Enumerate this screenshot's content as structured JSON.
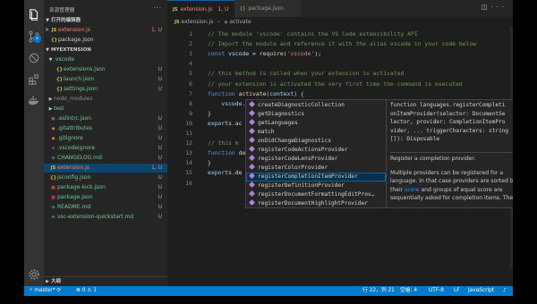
{
  "sidebar": {
    "title": "资源管理器",
    "open_editors_header": "打开的编辑器",
    "open_editors": [
      {
        "name": "extension.js",
        "icon": "js-icon",
        "status": "1, U"
      },
      {
        "name": "package.json",
        "icon": "json-icon",
        "status": ""
      }
    ],
    "project_header": "MYEXTENSION",
    "tree": [
      {
        "name": ".vscode",
        "type": "folder",
        "expanded": true,
        "status": ""
      },
      {
        "name": "extensions.json",
        "type": "json",
        "status": "U"
      },
      {
        "name": "launch.json",
        "type": "json",
        "status": "U"
      },
      {
        "name": "settings.json",
        "type": "json",
        "status": "U"
      },
      {
        "name": "node_modules",
        "type": "folder",
        "expanded": false,
        "status": ""
      },
      {
        "name": "test",
        "type": "folder",
        "expanded": false,
        "status": ""
      },
      {
        "name": ".eslintrc.json",
        "type": "eslint",
        "status": "U"
      },
      {
        "name": ".gitattributes",
        "type": "git",
        "status": "U"
      },
      {
        "name": ".gitignore",
        "type": "git",
        "status": "U"
      },
      {
        "name": ".vscodeignore",
        "type": "vscode",
        "status": "U"
      },
      {
        "name": "CHANGELOG.md",
        "type": "md",
        "status": "U"
      },
      {
        "name": "extension.js",
        "type": "js",
        "status": "1, U"
      },
      {
        "name": "jsconfig.json",
        "type": "json",
        "status": "U"
      },
      {
        "name": "package-lock.json",
        "type": "npm",
        "status": "U"
      },
      {
        "name": "package.json",
        "type": "npm",
        "status": "U"
      },
      {
        "name": "README.md",
        "type": "md",
        "status": "U"
      },
      {
        "name": "vsc-extension-quickstart.md",
        "type": "md",
        "status": "U"
      }
    ],
    "outline_header": "大纲"
  },
  "tabs": [
    {
      "label": "extension.js",
      "badge": "1, U",
      "active": true
    },
    {
      "label": "package.json",
      "badge": "",
      "active": false
    }
  ],
  "breadcrumb": {
    "file": "extension.js",
    "symbol": "activate"
  },
  "code": {
    "line_numbers": [
      "1",
      "2",
      "3",
      "4",
      "5",
      "6",
      "7",
      "8",
      "9",
      "10",
      "11",
      "12",
      "13",
      "14",
      "15",
      "16"
    ],
    "lines": [
      [
        [
          "c-com",
          "// The module 'vscode' contains the VS Code extensibility API"
        ]
      ],
      [
        [
          "c-com",
          "// Import the module and reference it with the alias vscode in your code below"
        ]
      ],
      [
        [
          "c-kw",
          "const "
        ],
        [
          "c-var",
          "vscode"
        ],
        [
          "c-pun",
          " = "
        ],
        [
          "c-fn",
          "require"
        ],
        [
          "c-pun",
          "("
        ],
        [
          "c-str",
          "'vscode'"
        ],
        [
          "c-pun",
          ");"
        ]
      ],
      [
        [
          "c-pun",
          ""
        ]
      ],
      [
        [
          "c-com",
          "// this method is called when your extension is activated"
        ]
      ],
      [
        [
          "c-com",
          "// your extension is activated the very first time the command is executed"
        ]
      ],
      [
        [
          "c-kw",
          "function "
        ],
        [
          "c-fn",
          "activate"
        ],
        [
          "c-pun",
          "("
        ],
        [
          "c-var",
          "context"
        ],
        [
          "c-pun",
          ") {"
        ]
      ],
      [
        [
          "c-pun",
          "    "
        ],
        [
          "c-var",
          "vscode"
        ],
        [
          "c-pun",
          "."
        ],
        [
          "c-var",
          "languages"
        ],
        [
          "c-pun",
          "."
        ]
      ],
      [
        [
          "c-pun",
          "}"
        ]
      ],
      [
        [
          "c-var",
          "exports"
        ],
        [
          "c-pun",
          ".ac"
        ]
      ],
      [
        [
          "c-pun",
          ""
        ]
      ],
      [
        [
          "c-com",
          "// this m"
        ]
      ],
      [
        [
          "c-kw",
          "function "
        ],
        [
          "c-pun",
          "de"
        ]
      ],
      [
        [
          "c-pun",
          "}"
        ]
      ],
      [
        [
          "c-var",
          "exports"
        ],
        [
          "c-pun",
          ".de"
        ]
      ],
      [
        [
          "c-pun",
          ""
        ]
      ]
    ]
  },
  "suggestions": {
    "items": [
      {
        "prefix": "",
        "rest": "createDiagnosticCollection",
        "kind": "method"
      },
      {
        "prefix": "",
        "rest": "getDiagnostics",
        "kind": "method"
      },
      {
        "prefix": "",
        "rest": "getLanguages",
        "kind": "method"
      },
      {
        "prefix": "",
        "rest": "match",
        "kind": "method"
      },
      {
        "prefix": "",
        "rest": "onDidChangeDiagnostics",
        "kind": "method"
      },
      {
        "prefix": "",
        "rest": "registerCodeActionsProvider",
        "kind": "method"
      },
      {
        "prefix": "",
        "rest": "registerCodeLensProvider",
        "kind": "method"
      },
      {
        "prefix": "",
        "rest": "registerColorProvider",
        "kind": "method"
      },
      {
        "prefix": "",
        "rest": "registerCompletionItemProvider",
        "kind": "method",
        "selected": true
      },
      {
        "prefix": "",
        "rest": "registerDefinitionProvider",
        "kind": "method"
      },
      {
        "prefix": "",
        "rest": "registerDocumentFormattingEditProv…",
        "kind": "method"
      },
      {
        "prefix": "",
        "rest": "registerDocumentHighlightProvider",
        "kind": "method"
      }
    ]
  },
  "details": {
    "signature": "function languages.registerCompleti\nonItemProvider(selector: DocumentSe\nlector, provider: CompletionItemPro\nvider, ... triggerCharacters: string\n[]): Disposable",
    "summary": "Register a completion provider.",
    "body_1": "Multiple providers can be registered for a language. In that case providers are sorted by their",
    "link": "score",
    "body_2": "and groups of equal score are sequentially asked for completion items. The"
  },
  "status_bar": {
    "branch": "master*",
    "sync": "⟳",
    "errors": "0",
    "warnings": "1",
    "position": "行 22，列 21",
    "spaces": "空格: 4",
    "encoding": "UTF-8",
    "eol": "LF",
    "language": "JavaScript"
  },
  "colors": {
    "accent": "#007acc",
    "selection": "#094771",
    "untracked": "#73c991",
    "error_file": "#f48771"
  }
}
